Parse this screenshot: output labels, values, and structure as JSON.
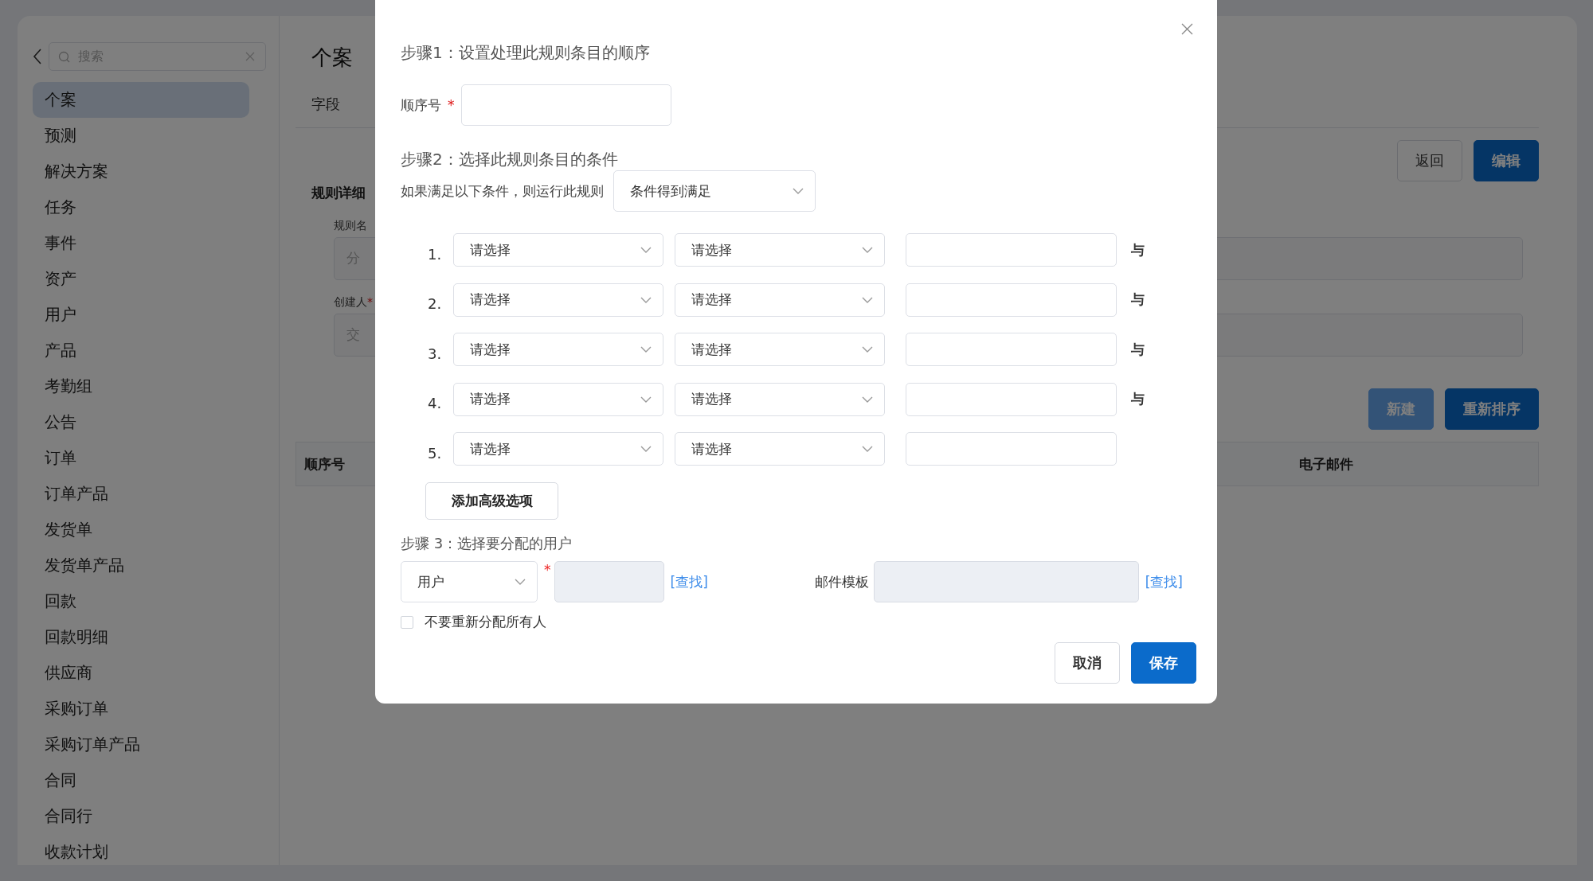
{
  "sidebar": {
    "search": {
      "placeholder": "搜索"
    },
    "items": [
      {
        "label": "个案",
        "selected": true
      },
      {
        "label": "预测",
        "selected": false
      },
      {
        "label": "解决方案",
        "selected": false
      },
      {
        "label": "任务",
        "selected": false
      },
      {
        "label": "事件",
        "selected": false
      },
      {
        "label": "资产",
        "selected": false
      },
      {
        "label": "用户",
        "selected": false
      },
      {
        "label": "产品",
        "selected": false
      },
      {
        "label": "考勤组",
        "selected": false
      },
      {
        "label": "公告",
        "selected": false
      },
      {
        "label": "订单",
        "selected": false
      },
      {
        "label": "订单产品",
        "selected": false
      },
      {
        "label": "发货单",
        "selected": false
      },
      {
        "label": "发货单产品",
        "selected": false
      },
      {
        "label": "回款",
        "selected": false
      },
      {
        "label": "回款明细",
        "selected": false
      },
      {
        "label": "供应商",
        "selected": false
      },
      {
        "label": "采购订单",
        "selected": false
      },
      {
        "label": "采购订单产品",
        "selected": false
      },
      {
        "label": "合同",
        "selected": false
      },
      {
        "label": "合同行",
        "selected": false
      },
      {
        "label": "收款计划",
        "selected": false
      }
    ]
  },
  "main": {
    "title": "个案",
    "tabs": [
      {
        "label": "字段",
        "selected": false
      }
    ],
    "actions": [
      {
        "label": "返回",
        "kind": "default"
      },
      {
        "label": "编辑",
        "kind": "primary"
      }
    ],
    "section_title": "规则详细",
    "fields": [
      {
        "label": "规则名",
        "placeholder": "分"
      },
      {
        "label": "创建人",
        "required_mark": "*",
        "placeholder": "交"
      }
    ],
    "list_actions": [
      {
        "label": "新建",
        "disabled": true
      },
      {
        "label": "重新排序",
        "disabled": false
      }
    ],
    "table": {
      "columns": [
        "顺序号",
        "电子邮件"
      ]
    }
  },
  "dialog": {
    "step1": {
      "heading": "步骤1：设置处理此规则条目的顺序",
      "order_label": "顺序号",
      "required_mark": "*"
    },
    "step2": {
      "heading": "步骤2：选择此规则条目的条件",
      "run_label": "如果满足以下条件，则运行此规则",
      "run_select": "条件得到满足",
      "conditions": [
        {
          "number": "1.",
          "field": "请选择",
          "operator": "请选择",
          "connector": "与"
        },
        {
          "number": "2.",
          "field": "请选择",
          "operator": "请选择",
          "connector": "与"
        },
        {
          "number": "3.",
          "field": "请选择",
          "operator": "请选择",
          "connector": "与"
        },
        {
          "number": "4.",
          "field": "请选择",
          "operator": "请选择",
          "connector": "与"
        },
        {
          "number": "5.",
          "field": "请选择",
          "operator": "请选择"
        }
      ],
      "add_button": "添加高级选项"
    },
    "step3": {
      "heading": "步骤 3：选择要分配的用户",
      "assignee_type": "用户",
      "required_mark": "*",
      "assignee_field": {
        "disabled": true
      },
      "lookup_link": "[查找]",
      "template_label": "邮件模板",
      "template_field": {
        "disabled": true
      },
      "template_lookup_link": "[查找]",
      "dont_reassign": {
        "label": "不要重新分配所有人",
        "checked": false
      }
    },
    "buttons": [
      {
        "label": "取消",
        "kind": "default"
      },
      {
        "label": "保存",
        "kind": "primary"
      }
    ]
  }
}
